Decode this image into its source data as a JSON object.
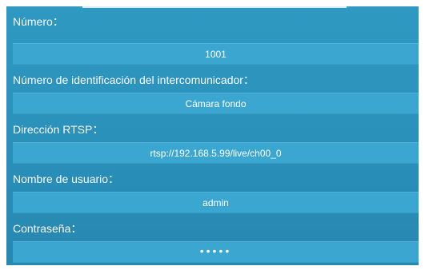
{
  "form": {
    "numero": {
      "label": "Número：",
      "value": "1001"
    },
    "intercom_id": {
      "label": "Número de identificación del intercomunicador：",
      "value": "Cámara fondo"
    },
    "rtsp": {
      "label": "Dirección RTSP：",
      "value": "rtsp://192.168.5.99/live/ch00_0"
    },
    "username": {
      "label": "Nombre de usuario：",
      "value": "admin"
    },
    "password": {
      "label": "Contraseña：",
      "value": "•••••"
    }
  }
}
